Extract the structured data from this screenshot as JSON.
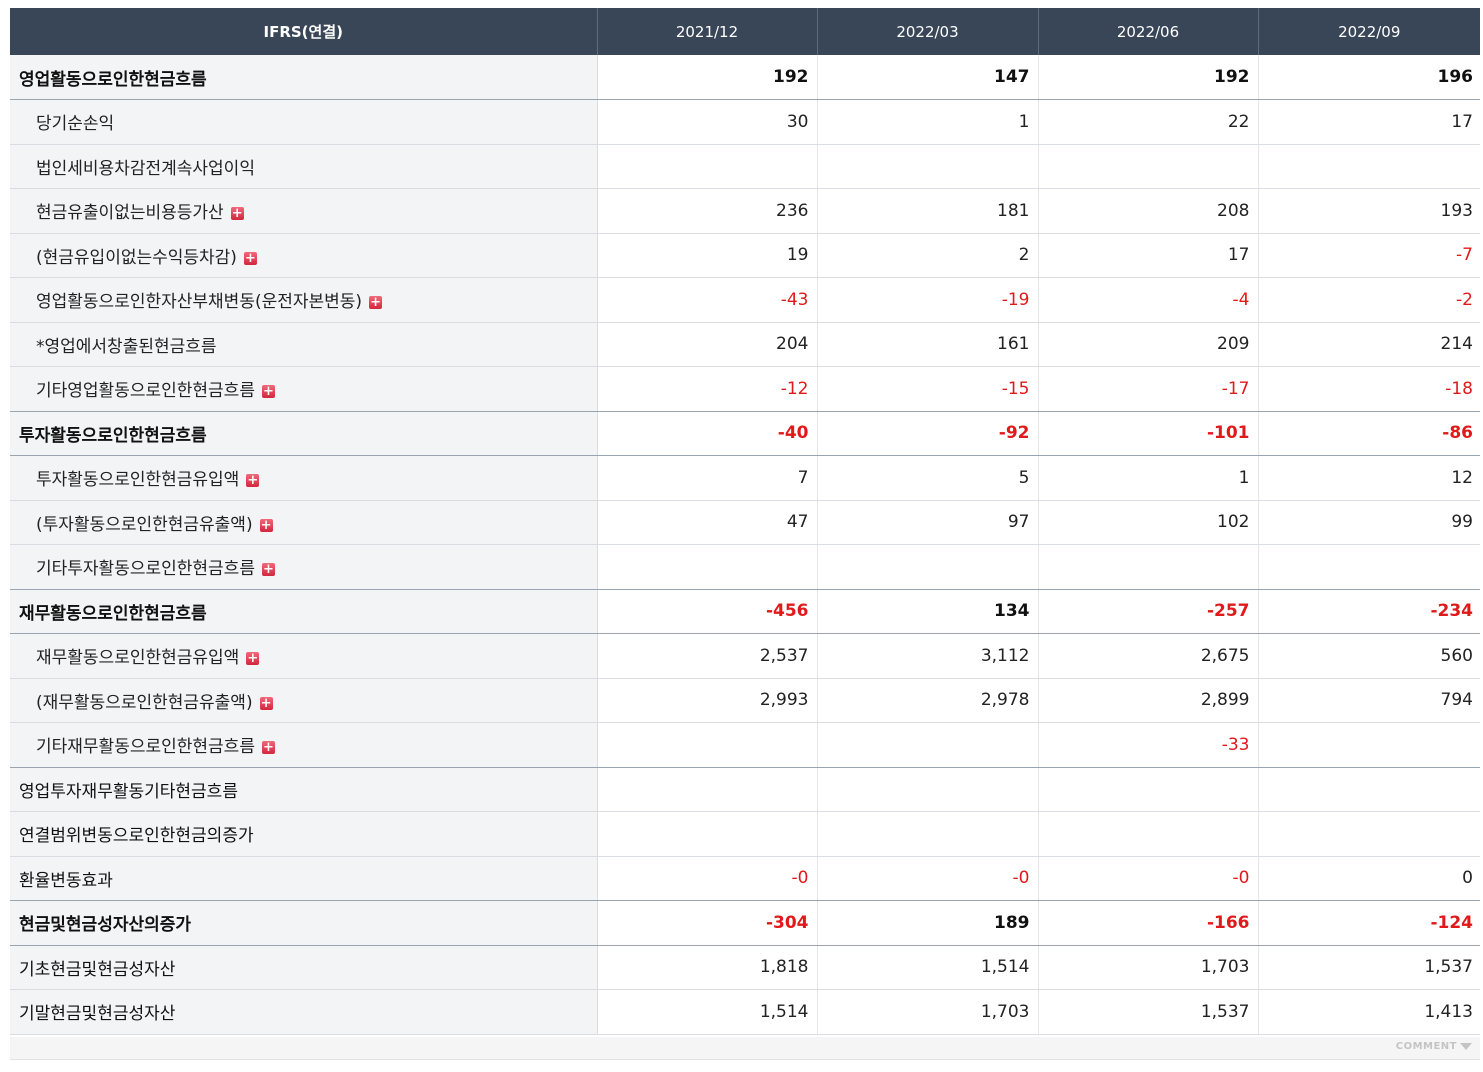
{
  "header": {
    "label": "IFRS(연결)",
    "periods": [
      "2021/12",
      "2022/03",
      "2022/06",
      "2022/09"
    ]
  },
  "rows": [
    {
      "label": "영업활동으로인한현금흐름",
      "values": [
        "192",
        "147",
        "192",
        "196"
      ],
      "level": "main",
      "expand": false
    },
    {
      "label": "당기순손익",
      "values": [
        "30",
        "1",
        "22",
        "17"
      ],
      "level": "sub",
      "expand": false
    },
    {
      "label": "법인세비용차감전계속사업이익",
      "values": [
        "",
        "",
        "",
        ""
      ],
      "level": "sub",
      "expand": false
    },
    {
      "label": "현금유출이없는비용등가산",
      "values": [
        "236",
        "181",
        "208",
        "193"
      ],
      "level": "sub",
      "expand": true
    },
    {
      "label": "(현금유입이없는수익등차감)",
      "values": [
        "19",
        "2",
        "17",
        "-7"
      ],
      "level": "sub",
      "expand": true
    },
    {
      "label": "영업활동으로인한자산부채변동(운전자본변동)",
      "values": [
        "-43",
        "-19",
        "-4",
        "-2"
      ],
      "level": "sub",
      "expand": true
    },
    {
      "label": "*영업에서창출된현금흐름",
      "values": [
        "204",
        "161",
        "209",
        "214"
      ],
      "level": "sub",
      "expand": false
    },
    {
      "label": "기타영업활동으로인한현금흐름",
      "values": [
        "-12",
        "-15",
        "-17",
        "-18"
      ],
      "level": "sub",
      "expand": true
    },
    {
      "label": "투자활동으로인한현금흐름",
      "values": [
        "-40",
        "-92",
        "-101",
        "-86"
      ],
      "level": "main",
      "expand": false
    },
    {
      "label": "투자활동으로인한현금유입액",
      "values": [
        "7",
        "5",
        "1",
        "12"
      ],
      "level": "sub",
      "expand": true
    },
    {
      "label": "(투자활동으로인한현금유출액)",
      "values": [
        "47",
        "97",
        "102",
        "99"
      ],
      "level": "sub",
      "expand": true
    },
    {
      "label": "기타투자활동으로인한현금흐름",
      "values": [
        "",
        "",
        "",
        ""
      ],
      "level": "sub",
      "expand": true
    },
    {
      "label": "재무활동으로인한현금흐름",
      "values": [
        "-456",
        "134",
        "-257",
        "-234"
      ],
      "level": "main",
      "expand": false
    },
    {
      "label": "재무활동으로인한현금유입액",
      "values": [
        "2,537",
        "3,112",
        "2,675",
        "560"
      ],
      "level": "sub",
      "expand": true
    },
    {
      "label": "(재무활동으로인한현금유출액)",
      "values": [
        "2,993",
        "2,978",
        "2,899",
        "794"
      ],
      "level": "sub",
      "expand": true
    },
    {
      "label": "기타재무활동으로인한현금흐름",
      "values": [
        "",
        "",
        "-33",
        ""
      ],
      "level": "sub",
      "expand": true
    },
    {
      "label": "영업투자재무활동기타현금흐름",
      "values": [
        "",
        "",
        "",
        ""
      ],
      "level": "plain",
      "expand": false
    },
    {
      "label": "연결범위변동으로인한현금의증가",
      "values": [
        "",
        "",
        "",
        ""
      ],
      "level": "plain",
      "expand": false
    },
    {
      "label": "환율변동효과",
      "values": [
        "-0",
        "-0",
        "-0",
        "0"
      ],
      "level": "plain",
      "expand": false
    },
    {
      "label": "현금및현금성자산의증가",
      "values": [
        "-304",
        "189",
        "-166",
        "-124"
      ],
      "level": "main",
      "expand": false
    },
    {
      "label": "기초현금및현금성자산",
      "values": [
        "1,818",
        "1,514",
        "1,703",
        "1,537"
      ],
      "level": "plain",
      "expand": false
    },
    {
      "label": "기말현금및현금성자산",
      "values": [
        "1,514",
        "1,703",
        "1,537",
        "1,413"
      ],
      "level": "plain",
      "expand": false
    }
  ],
  "footer": {
    "comment_label": "COMMENT",
    "comment_icon": "triangle-down-icon"
  },
  "colors": {
    "header_bg": "#394658",
    "negative": "#e0191b",
    "label_bg": "#f3f4f6",
    "expand_icon": "#d3263d"
  }
}
